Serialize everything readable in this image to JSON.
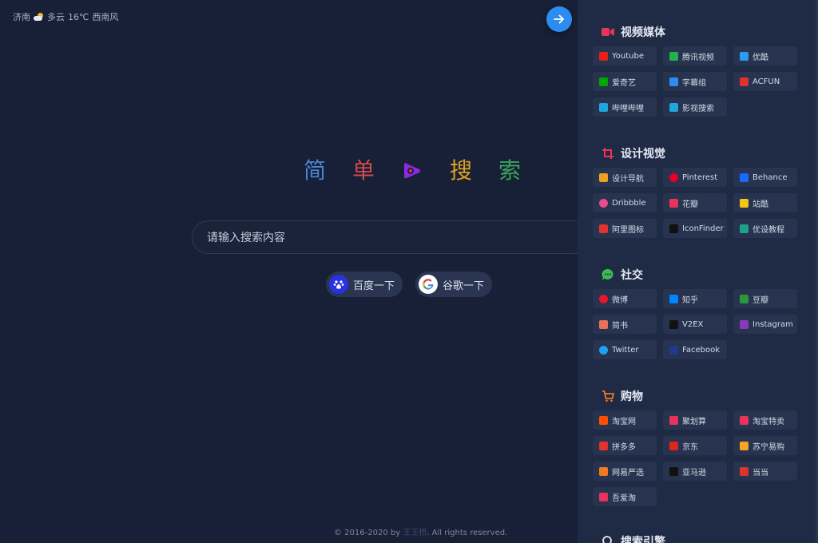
{
  "weather": {
    "city": "济南",
    "condition": "多云",
    "temp": "16℃",
    "wind": "西南风"
  },
  "logo": {
    "chars": [
      "简",
      "单",
      "搜",
      "索"
    ],
    "colors": [
      "#4a86d4",
      "#d24a4a",
      "#e0a020",
      "#3aa35a"
    ]
  },
  "search": {
    "placeholder": "请输入搜索内容"
  },
  "engines": [
    {
      "label": "百度一下",
      "icon": "baidu-icon"
    },
    {
      "label": "谷歌一下",
      "icon": "google-icon"
    }
  ],
  "footer": {
    "prefix": "© 2016-2020 by",
    "author": "王王桥",
    "suffix": ". All rights reserved."
  },
  "sidebar": {
    "sections": [
      {
        "title": "视频媒体",
        "icon": "video-camera-icon",
        "icon_color": "#e8345a",
        "items": [
          {
            "label": "Youtube",
            "color": "#e62117"
          },
          {
            "label": "腾讯视频",
            "color": "#22b14c"
          },
          {
            "label": "优酷",
            "color": "#2d9cf0"
          },
          {
            "label": "爱奇艺",
            "color": "#00a700"
          },
          {
            "label": "字幕组",
            "color": "#2d8cf0"
          },
          {
            "label": "ACFUN",
            "color": "#e0322e"
          },
          {
            "label": "哔哩哔哩",
            "color": "#1fa6dd"
          },
          {
            "label": "影视搜索",
            "color": "#1fa6dd"
          }
        ]
      },
      {
        "title": "设计视觉",
        "icon": "crop-icon",
        "icon_color": "#e8345a",
        "items": [
          {
            "label": "设计导航",
            "color": "#f0a020"
          },
          {
            "label": "Pinterest",
            "color": "#e60023"
          },
          {
            "label": "Behance",
            "color": "#1769ff"
          },
          {
            "label": "Dribbble",
            "color": "#ea4c89"
          },
          {
            "label": "花瓣",
            "color": "#e8345a"
          },
          {
            "label": "站酷",
            "color": "#f5c518"
          },
          {
            "label": "阿里图标",
            "color": "#e0322e"
          },
          {
            "label": "IconFinder",
            "color": "#111111"
          },
          {
            "label": "优设教程",
            "color": "#1aa38a"
          }
        ]
      },
      {
        "title": "社交",
        "icon": "chat-bubble-icon",
        "icon_color": "#3cba54",
        "items": [
          {
            "label": "微博",
            "color": "#e6162d"
          },
          {
            "label": "知乎",
            "color": "#0084ff"
          },
          {
            "label": "豆瓣",
            "color": "#2e963d"
          },
          {
            "label": "简书",
            "color": "#ea6f5a"
          },
          {
            "label": "V2EX",
            "color": "#111111"
          },
          {
            "label": "Instagram",
            "color": "#8a3ab9"
          },
          {
            "label": "Twitter",
            "color": "#1da1f2"
          },
          {
            "label": "Facebook",
            "color": "#1f3a8a"
          }
        ]
      },
      {
        "title": "购物",
        "icon": "shopping-cart-icon",
        "icon_color": "#f07a22",
        "items": [
          {
            "label": "淘宝网",
            "color": "#ff5000"
          },
          {
            "label": "聚划算",
            "color": "#e8345a"
          },
          {
            "label": "淘宝特卖",
            "color": "#e8345a"
          },
          {
            "label": "拼多多",
            "color": "#e0322e"
          },
          {
            "label": "京东",
            "color": "#e1251b"
          },
          {
            "label": "苏宁易购",
            "color": "#f5a623"
          },
          {
            "label": "网易严选",
            "color": "#f07a22"
          },
          {
            "label": "亚马逊",
            "color": "#111111"
          },
          {
            "label": "当当",
            "color": "#e0322e"
          },
          {
            "label": "吾爱淘",
            "color": "#e8345a"
          }
        ]
      },
      {
        "title": "搜索引擎",
        "icon": "search-icon",
        "icon_color": "#e4e9f3",
        "items": []
      }
    ]
  }
}
